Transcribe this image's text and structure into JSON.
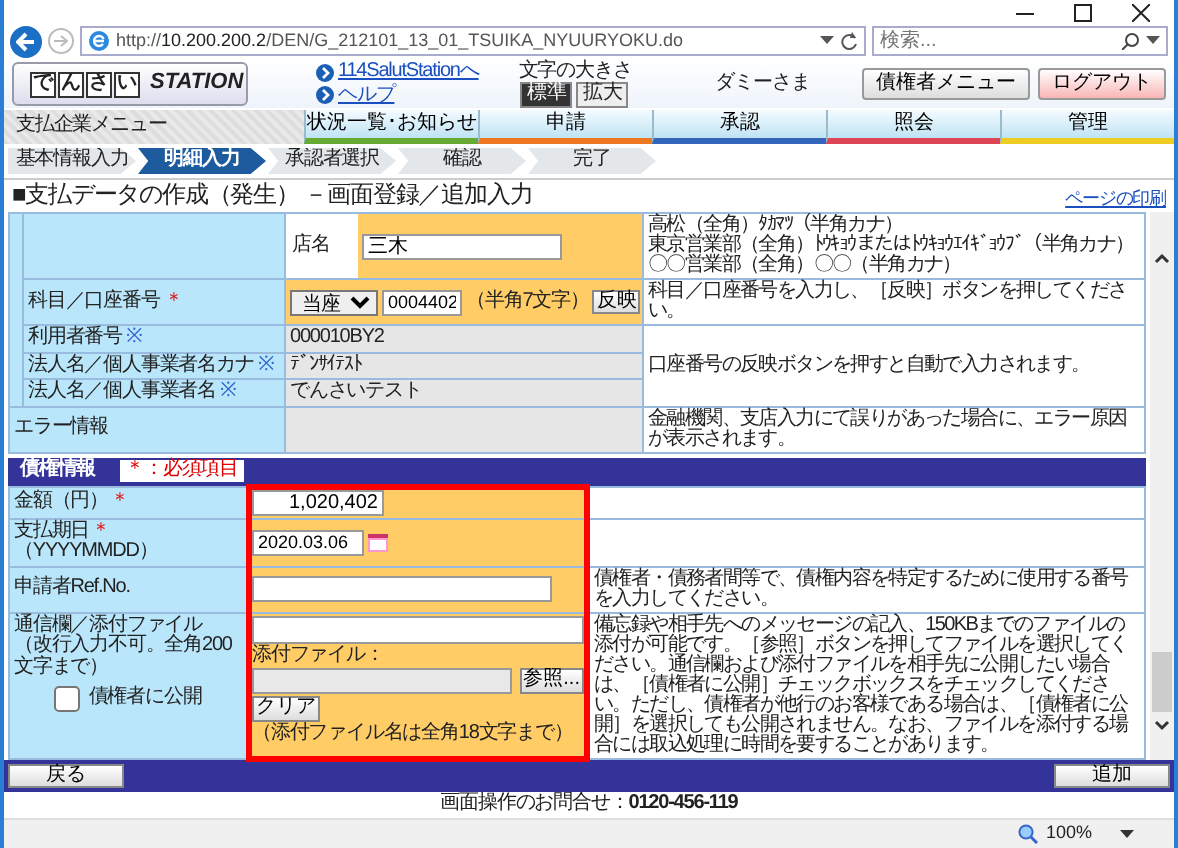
{
  "browser": {
    "url": "http://**10.200.200.2**/DEN/G_212101_13_01_TSUIKA_NYUURYOKU.do",
    "search_placeholder": "検索...",
    "zoom": "100%"
  },
  "header": {
    "logo": {
      "tiles": [
        "で",
        "ん",
        "さ",
        "い"
      ],
      "text": "STATION"
    },
    "links": [
      "114SalutStationへ",
      "ヘルプ"
    ],
    "font_size_label": "文字の大きさ",
    "font_sizes": [
      {
        "label": "標準",
        "selected": true
      },
      {
        "label": "拡大",
        "selected": false
      }
    ],
    "user": "ダミーさま",
    "buttons": [
      {
        "label": "債権者メニュー",
        "kind": "menu"
      },
      {
        "label": "ログアウト",
        "kind": "logout"
      }
    ]
  },
  "menu": {
    "title": "支払企業メニュー",
    "tabs": [
      {
        "label": "状況一覧･お知らせ",
        "color": "#66aa33"
      },
      {
        "label": "申請",
        "color": "#ee7722"
      },
      {
        "label": "承認",
        "color": "#3366bb"
      },
      {
        "label": "照会",
        "color": "#dd4455"
      },
      {
        "label": "管理",
        "color": "#eecc22"
      }
    ]
  },
  "steps": [
    {
      "label": "基本情報入力",
      "selected": false
    },
    {
      "label": "明細入力",
      "selected": true
    },
    {
      "label": "承認者選択",
      "selected": false
    },
    {
      "label": "確認",
      "selected": false
    },
    {
      "label": "完了",
      "selected": false
    }
  ],
  "page_title": "■支払データの作成（発生） －画面登録／追加入力",
  "print_link": "ページの印刷",
  "payee": {
    "rows": [
      {
        "kind": "branch",
        "sub_label": "店名",
        "value": "三木",
        "help": [
          "高松（全角）ﾀｶﾏﾂ（半角カナ）",
          "東京営業部（全角）ﾄｳｷｮｳまたはﾄｳｷｮｳｴｲｷﾞｮｳﾌﾞ（半角カナ）",
          "〇〇営業部（全角）〇〇（半角カナ）"
        ]
      },
      {
        "kind": "account",
        "label": "科目／口座番号",
        "mark": {
          "text": "＊",
          "kind": "required"
        },
        "select": "当座",
        "value": "0004402",
        "note": "（半角7文字）",
        "button": "反映",
        "help": "科目／口座番号を入力し、［反映］ボタンを押してください。"
      },
      {
        "kind": "auto",
        "label": "利用者番号",
        "mark": {
          "text": "※",
          "kind": "auto"
        },
        "value": "000010BY2"
      },
      {
        "kind": "auto",
        "label": "法人名／個人事業者名カナ",
        "mark": {
          "text": "※",
          "kind": "auto"
        },
        "value": "ﾃﾞﾝｻｲﾃｽﾄ"
      },
      {
        "kind": "auto",
        "label": "法人名／個人事業者名",
        "mark": {
          "text": "※",
          "kind": "auto"
        },
        "value": "でんさいテスト"
      }
    ],
    "auto_help": "口座番号の反映ボタンを押すと自動で入力されます。",
    "error": {
      "label": "エラー情報",
      "help": "金融機関、支店入力にて誤りがあった場合に、エラー原因が表示されます。"
    }
  },
  "claim": {
    "title": "債権情報",
    "legend": "＊：必須項目",
    "highlighted": true,
    "rows": [
      {
        "kind": "amount",
        "label": "金額（円）",
        "mark": {
          "text": "＊",
          "kind": "required"
        },
        "value": "1,020,402"
      },
      {
        "kind": "date",
        "label": "支払期日",
        "mark": {
          "text": "＊",
          "kind": "required"
        },
        "suffix": "（YYYYMMDD）",
        "value": "2020.03.06"
      },
      {
        "kind": "text",
        "label": "申請者Ref.No.",
        "help": "債権者・債務者間等で、債権内容を特定するために使用する番号を入力してください。"
      },
      {
        "kind": "message",
        "label": "通信欄／添付ファイル",
        "note": "（改行入力不可。全角200文字まで）",
        "checkbox": {
          "label": "債権者に公開",
          "checked": false
        },
        "attach_label": "添付ファイル：",
        "browse": "参照...",
        "clear": "クリア",
        "attach_note": "（添付ファイル名は全角18文字まで）",
        "help": "備忘録や相手先へのメッセージの記入、150KBまでのファイルの添付が可能です。［参照］ボタンを押してファイルを選択してください。通信欄および添付ファイルを相手先に公開したい場合は、［債権者に公開］チェックボックスをチェックしてください。ただし、債権者が他行のお客様である場合は、［債権者に公開］を選択しても公開されません。なお、ファイルを添付する場合には取込処理に時間を要することがあります。"
      }
    ]
  },
  "footer": {
    "back": "戻る",
    "add": "追加",
    "contact_label": "画面操作のお問合せ：",
    "phone": "0120-456-119"
  }
}
